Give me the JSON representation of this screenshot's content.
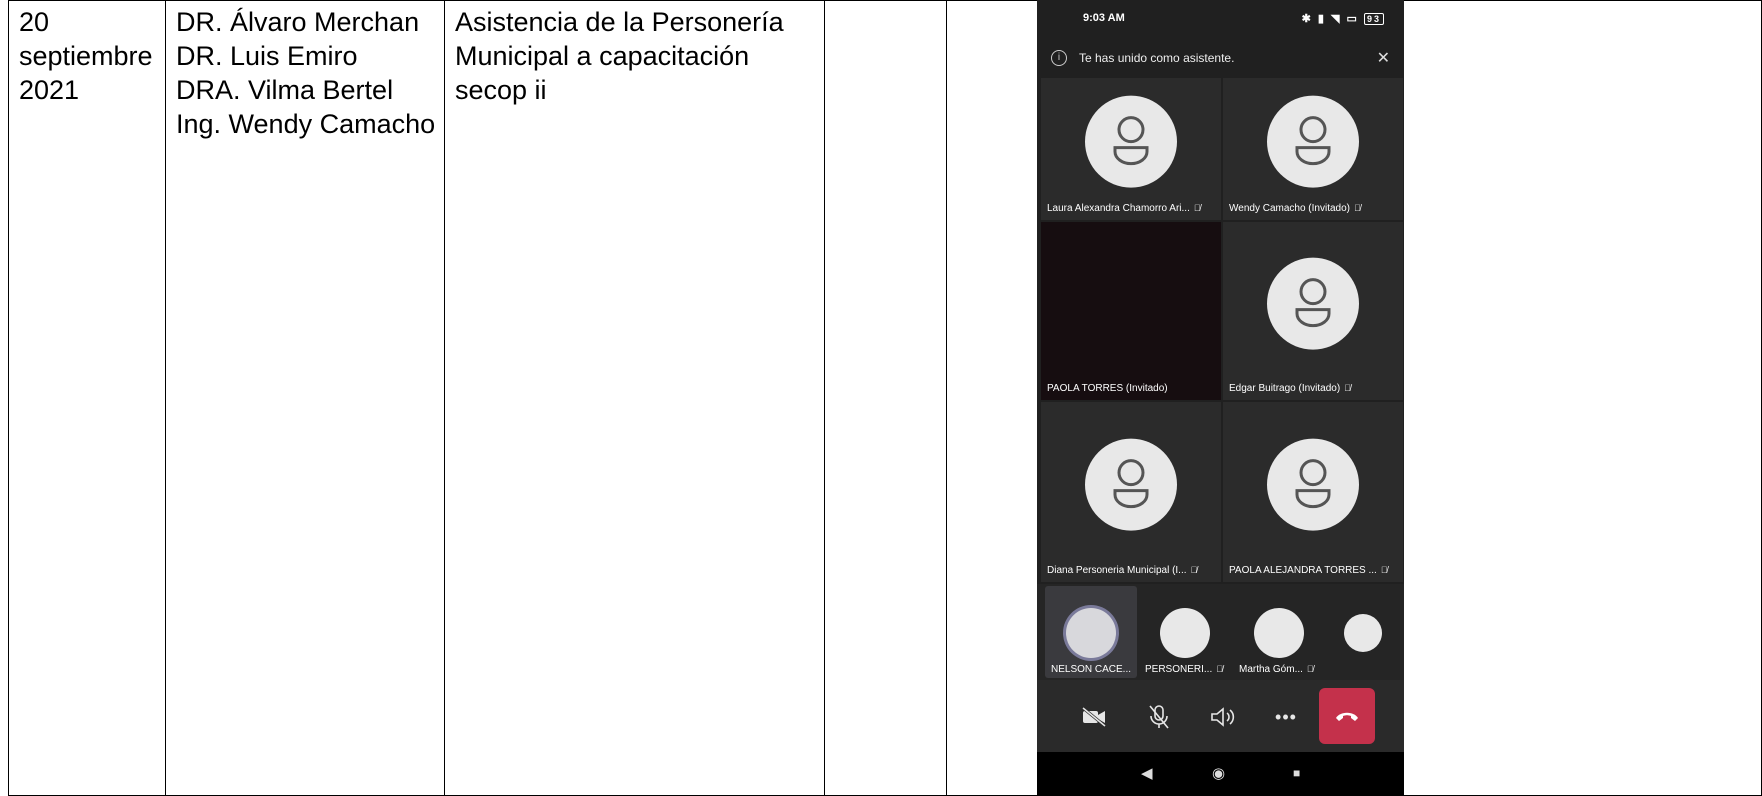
{
  "row": {
    "date_lines": [
      "20",
      "septiembre",
      "2021"
    ],
    "attendee_lines": [
      "DR. Álvaro Merchan",
      "DR. Luis Emiro",
      "DRA. Vilma Bertel",
      "Ing. Wendy Camacho"
    ],
    "activity_lines": [
      "Asistencia de la Personería",
      "Municipal a capacitación",
      "secop ii"
    ],
    "notes": ""
  },
  "phone": {
    "status_time": "9:03 AM",
    "status_icons": "✱ ▮ ◥ ▭",
    "battery": "93",
    "banner_text": "Te has unido como asistente.",
    "tiles": [
      {
        "name": "Laura Alexandra Chamorro Ari...",
        "muted": true
      },
      {
        "name": "Wendy Camacho (Invitado)",
        "muted": true
      },
      {
        "name": "PAOLA TORRES (Invitado)",
        "muted": false
      },
      {
        "name": "Edgar Buitrago (Invitado)",
        "muted": true
      },
      {
        "name": "Diana Personeria Municipal (I...",
        "muted": true
      },
      {
        "name": "PAOLA ALEJANDRA TORRES ...",
        "muted": true
      }
    ],
    "strip": [
      {
        "name": "NELSON CACE...",
        "muted": false
      },
      {
        "name": "PERSONERI...",
        "muted": true
      },
      {
        "name": "Martha Góm...",
        "muted": true
      },
      {
        "name": "",
        "muted": false
      }
    ],
    "controls": {
      "camera_icon": "camera-off-icon",
      "mic_icon": "mic-off-icon",
      "speaker_icon": "speaker-icon",
      "more_icon": "more-icon",
      "hangup_icon": "hangup-icon",
      "hangup_color": "#c4314b"
    },
    "nav": {
      "back": "◀",
      "home": "◉",
      "recents": "■"
    }
  }
}
